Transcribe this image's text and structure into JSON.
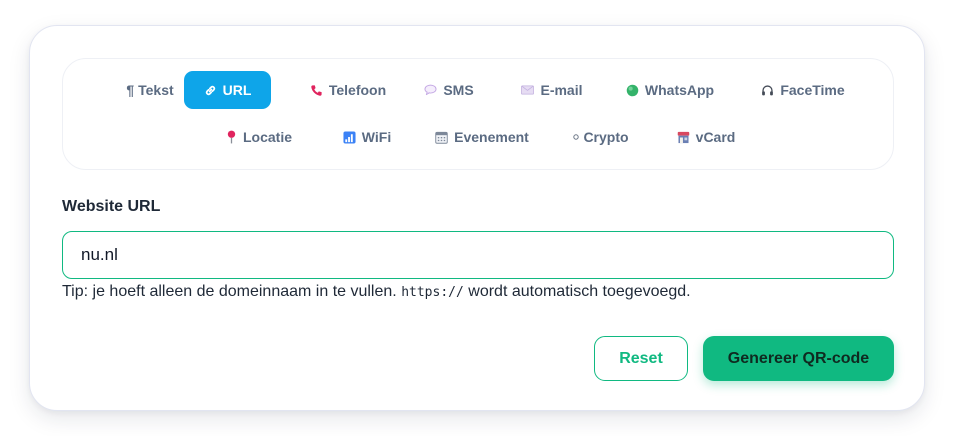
{
  "tabs": [
    {
      "id": "tekst",
      "label": "Tekst",
      "glyph": "¶",
      "icon": "pilcrow-icon"
    },
    {
      "id": "url",
      "label": "URL",
      "icon": "link-icon",
      "active": true
    },
    {
      "id": "telefoon",
      "label": "Telefoon",
      "icon": "phone-icon"
    },
    {
      "id": "sms",
      "label": "SMS",
      "icon": "speech-bubble-icon"
    },
    {
      "id": "email",
      "label": "E-mail",
      "icon": "envelope-icon"
    },
    {
      "id": "whatsapp",
      "label": "WhatsApp",
      "icon": "green-circle-icon"
    },
    {
      "id": "facetime",
      "label": "FaceTime",
      "icon": "headphones-icon"
    },
    {
      "id": "locatie",
      "label": "Locatie",
      "icon": "pushpin-icon"
    },
    {
      "id": "wifi",
      "label": "WiFi",
      "icon": "signal-bars-icon"
    },
    {
      "id": "evenement",
      "label": "Evenement",
      "icon": "calendar-icon"
    },
    {
      "id": "crypto",
      "label": "Crypto",
      "icon": "small-circle-icon"
    },
    {
      "id": "vcard",
      "label": "vCard",
      "icon": "contact-card-icon"
    }
  ],
  "form": {
    "label": "Website URL",
    "value": "nu.nl",
    "tip_prefix": "Tip: je hoeft alleen de domeinnaam in te vullen.",
    "tip_code": "https://",
    "tip_suffix": "wordt automatisch toegevoegd."
  },
  "buttons": {
    "reset": "Reset",
    "generate": "Genereer QR-code"
  },
  "colors": {
    "accent_blue": "#0ea5e9",
    "accent_green": "#10b981",
    "tab_text": "#5b6b82",
    "text": "#1f2937"
  }
}
